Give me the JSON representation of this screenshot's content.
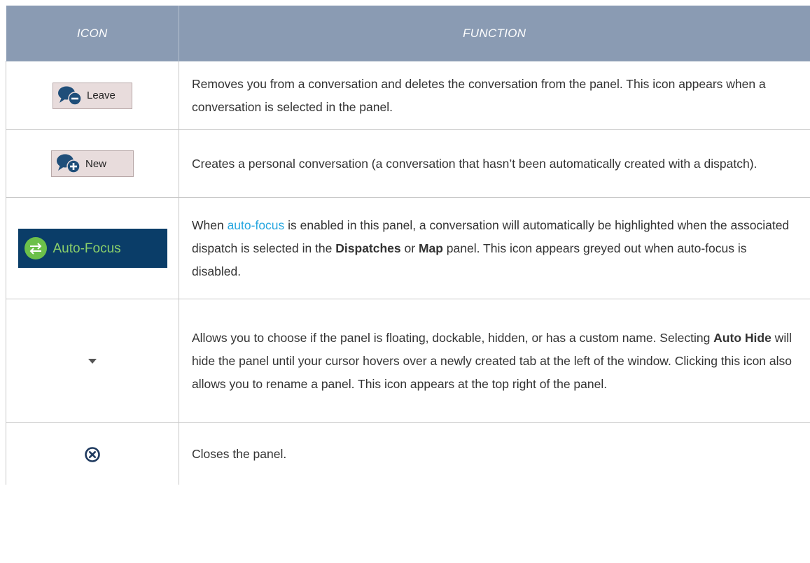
{
  "header": {
    "icon_col": "ICON",
    "function_col": "FUNCTION"
  },
  "colors": {
    "header_bg": "#8a9bb3",
    "link": "#28a7e0",
    "autofocus_bg": "#0a3d68",
    "autofocus_green": "#8bd06a"
  },
  "rows": [
    {
      "icon": "leave-conversation-icon",
      "icon_label": "Leave",
      "text": "Removes you from a conversation and deletes the conversation from the panel. This icon appears when a conversation is selected in the panel."
    },
    {
      "icon": "new-conversation-icon",
      "icon_label": "New",
      "text": "Creates a personal conversation (a conversation that hasn’t been automatically created with a dispatch)."
    },
    {
      "icon": "auto-focus-icon",
      "icon_label": "Auto-Focus",
      "text_pre": "When ",
      "link": "auto-focus",
      "text_mid1": " is enabled in this panel, a conversation will automatically be highlighted when the associated dispatch is selected in the ",
      "bold1": "Dispatches",
      "text_mid2": " or ",
      "bold2": "Map",
      "text_post": " panel. This icon appears greyed out when auto-focus is disabled."
    },
    {
      "icon": "caret-down-icon",
      "text_pre": "Allows you to choose if the panel is floating, dockable, hidden, or has a custom name. Selecting ",
      "bold1": "Auto Hide",
      "text_post": " will hide the panel until your cursor hovers over a newly created tab at the left of the window. Clicking this icon also allows you to rename a panel. This icon appears at the top right of the panel."
    },
    {
      "icon": "close-circle-icon",
      "text": "Closes the panel."
    }
  ]
}
